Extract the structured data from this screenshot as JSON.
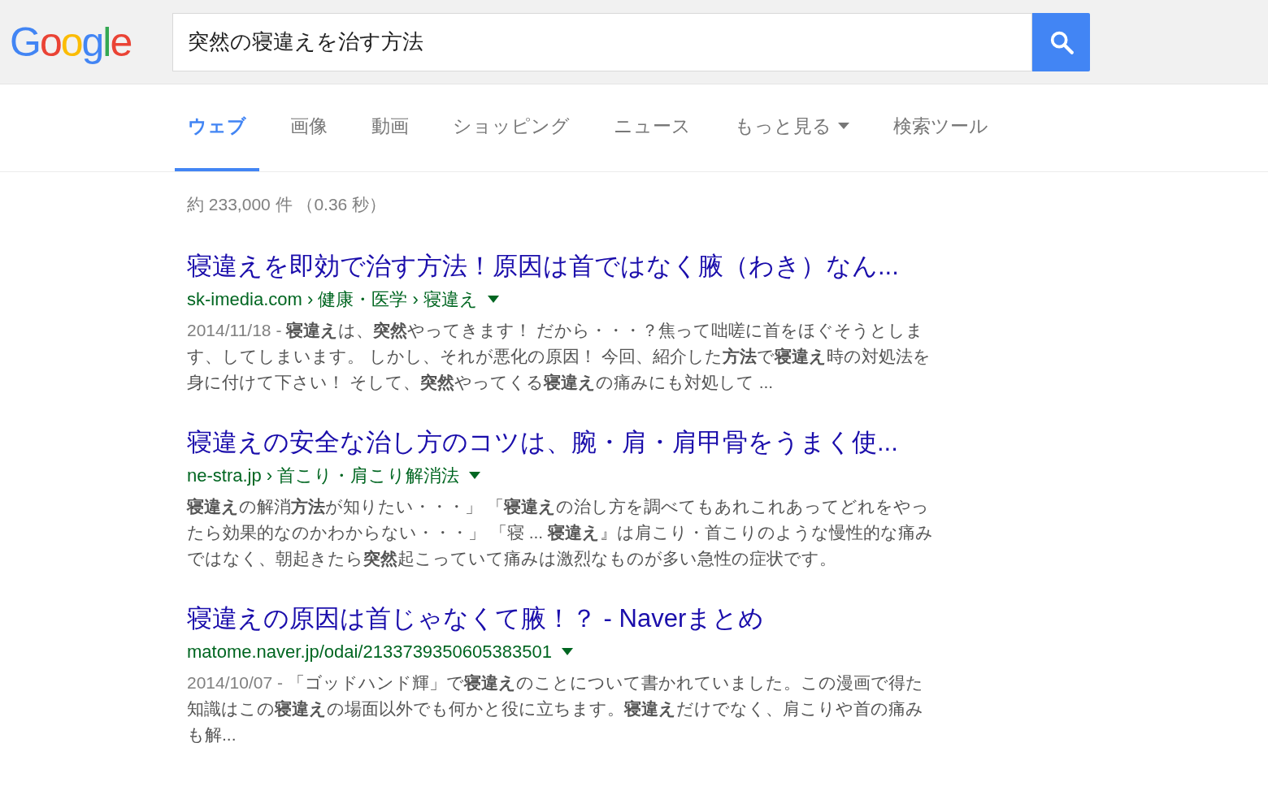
{
  "logo": "Google",
  "search": {
    "value": "突然の寝違えを治す方法"
  },
  "tabs": [
    {
      "label": "ウェブ",
      "selected": true,
      "caret": false
    },
    {
      "label": "画像",
      "selected": false,
      "caret": false
    },
    {
      "label": "動画",
      "selected": false,
      "caret": false
    },
    {
      "label": "ショッピング",
      "selected": false,
      "caret": false
    },
    {
      "label": "ニュース",
      "selected": false,
      "caret": false
    },
    {
      "label": "もっと見る",
      "selected": false,
      "caret": true
    },
    {
      "label": "検索ツール",
      "selected": false,
      "caret": false
    }
  ],
  "result_stats": "約 233,000 件 （0.36 秒）",
  "results": [
    {
      "title": "寝違えを即効で治す方法！原因は首ではなく腋（わき）なん...",
      "url": "sk-imedia.com › 健康・医学 › 寝違え",
      "date": "2014/11/18 - ",
      "snippet": "**寝違え**は、**突然**やってきます！ だから・・・？焦って咄嗟に首をほぐそうとします、してしまいます。 しかし、それが悪化の原因！ 今回、紹介した**方法**で**寝違え**時の対処法を身に付けて下さい！ そして、**突然**やってくる**寝違え**の痛みにも対処して ..."
    },
    {
      "title": "寝違えの安全な治し方のコツは、腕・肩・肩甲骨をうまく使...",
      "url": "ne-stra.jp › 首こり・肩こり解消法",
      "snippet": "**寝違え**の解消**方法**が知りたい・・・」 「**寝違え**の治し方を調べてもあれこれあってどれをやったら効果的なのかわからない・・・」 「寝 ... **寝違え**』は肩こり・首こりのような慢性的な痛みではなく、朝起きたら**突然**起こっていて痛みは激烈なものが多い急性の症状です。"
    },
    {
      "title": "寝違えの原因は首じゃなくて腋！？ - Naverまとめ",
      "url": "matome.naver.jp/odai/2133739350605383501",
      "date": "2014/10/07 - ",
      "snippet": "「ゴッドハンド輝」で**寝違え**のことについて書かれていました。この漫画で得た知識はこの**寝違え**の場面以外でも何かと役に立ちます。**寝違え**だけでなく、肩こりや首の痛みも解..."
    }
  ]
}
